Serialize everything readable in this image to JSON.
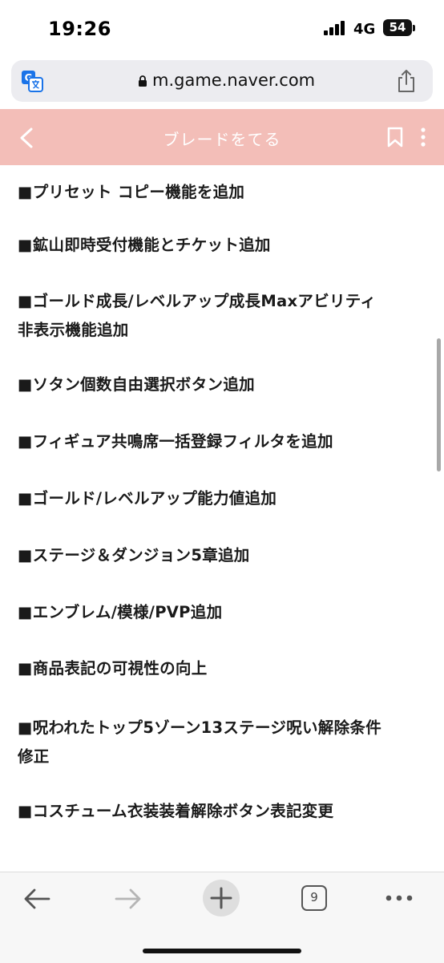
{
  "status_bar": {
    "time": "19:26",
    "network": "4G",
    "battery": "54"
  },
  "browser": {
    "url": "m.game.naver.com",
    "icons": [
      "translate-icon",
      "lock-icon",
      "share-icon"
    ]
  },
  "page_header": {
    "title": "ブレードをてる",
    "background_color": "#f3beb8",
    "icons": [
      "back-icon",
      "bookmark-icon",
      "more-icon"
    ]
  },
  "notice_items": [
    {
      "lines": [
        "■プリセット コピー機能を追加"
      ]
    },
    {
      "lines": [
        "■鉱山即時受付機能とチケット追加"
      ]
    },
    {
      "lines": [
        "■ゴールド成長/レベルアップ成長Maxアビリティ",
        "非表示機能追加"
      ]
    },
    {
      "lines": [
        "■ソタン個数自由選択ボタン追加"
      ]
    },
    {
      "lines": [
        "■フィギュア共鳴席一括登録フィルタを追加"
      ]
    },
    {
      "lines": [
        "■ゴールド/レベルアップ能力値追加"
      ]
    },
    {
      "lines": [
        "■ステージ＆ダンジョン5章追加"
      ]
    },
    {
      "lines": [
        "■エンブレム/模様/PVP追加"
      ]
    },
    {
      "lines": [
        "■商品表記の可視性の向上"
      ]
    },
    {
      "lines": [
        "■呪われたトップ5ゾーン13ステージ呪い解除条件",
        "修正"
      ]
    },
    {
      "lines": [
        "■コスチューム衣装装着解除ボタン表記変更"
      ]
    }
  ],
  "toolbar": {
    "tab_count": "9",
    "icons": [
      "back-arrow-icon",
      "forward-arrow-icon",
      "new-tab-plus-icon",
      "tabs-icon",
      "more-dots-icon"
    ]
  }
}
